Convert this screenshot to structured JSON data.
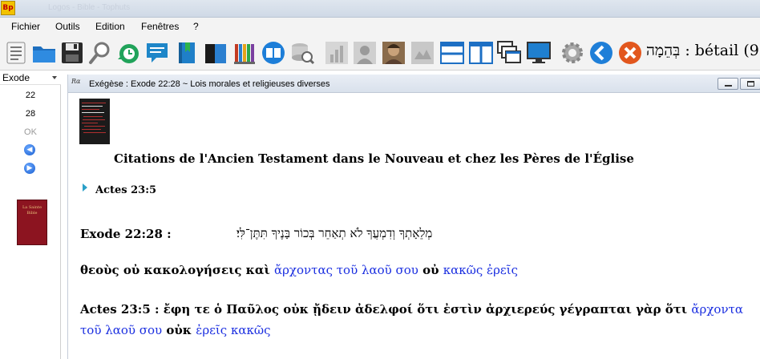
{
  "titlebar": {
    "app_icon_text": "Bp",
    "window_title": "Logos - Bible - Tophuts"
  },
  "menu": {
    "items": [
      "Fichier",
      "Outils",
      "Edition",
      "Fenêtres",
      "?"
    ]
  },
  "toolbar": {
    "label": "בְּהֵמָה : bétail (9",
    "icons": [
      "list-icon",
      "folder-icon",
      "save-icon",
      "search-icon",
      "refresh-clock-icon",
      "comment-icon",
      "book-bookmark-icon",
      "books-icon",
      "library-icon",
      "bible-reader-icon",
      "database-search-icon",
      "bar-chart-icon",
      "portrait-icon",
      "photo-icon",
      "map-icon",
      "horizontal-split-icon",
      "vertical-split-icon",
      "cascade-windows-icon",
      "monitor-icon",
      "gear-icon",
      "back-arrow-icon",
      "close-icon"
    ],
    "accent": "#2b73d6"
  },
  "leftpanel": {
    "book": "Exode",
    "chapter": "22",
    "verse": "28",
    "ok_label": "OK",
    "bible_cover_text": "La Sainte Bible"
  },
  "document": {
    "title": "Exégèse : Exode 22:28 ~ Lois morales et religieuses diverses",
    "heading": "Citations de l'Ancien Testament dans le Nouveau et chez les Pères de l'Église",
    "reference": "Actes 23:5",
    "exode_label": "Exode 22:28 :",
    "exode_hebrew": "מְלֵאָתְךָ וְדִמְעֲךָ לֹא תְאַחֵר בְּכוֹר בָּנֶיךָ תִּתֶּן־לִּי׃",
    "greek1": [
      {
        "text": "θεοὺς οὐ κακολογήσεις καὶ ",
        "blue": false
      },
      {
        "text": "ἄρχοντας τοῦ λαοῦ σου",
        "blue": true
      },
      {
        "text": " οὐ ",
        "blue": false
      },
      {
        "text": "κακῶς ἐρεῖς",
        "blue": true
      }
    ],
    "acts": [
      {
        "text": "Actes 23:5 : ἔφη τε ὁ Παῦλος οὐκ ᾔδειν ἀδελφοί ὅτι ἐστὶν ἀρχιερεύς γέγραπται γὰρ ὅτι ",
        "blue": false
      },
      {
        "text": "ἄρχοντα τοῦ λαοῦ σου",
        "blue": true
      },
      {
        "text": " οὐκ ",
        "blue": false
      },
      {
        "text": "ἐρεῖς κακῶς",
        "blue": true
      }
    ],
    "link_color": "#1a2ee0"
  }
}
